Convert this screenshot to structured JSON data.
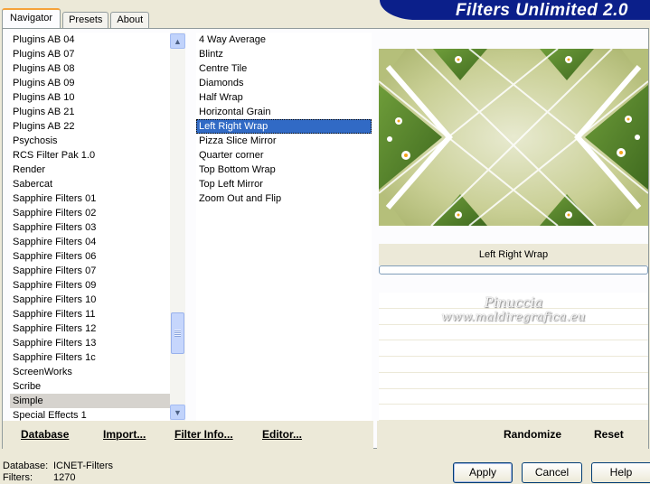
{
  "header": {
    "title": "Filters Unlimited 2.0",
    "color": "#0b1f8a"
  },
  "tabs": [
    {
      "label": "Navigator",
      "active": true
    },
    {
      "label": "Presets",
      "active": false
    },
    {
      "label": "About",
      "active": false
    }
  ],
  "categories": {
    "items": [
      "Plugins AB 04",
      "Plugins AB 07",
      "Plugins AB 08",
      "Plugins AB 09",
      "Plugins AB 10",
      "Plugins AB 21",
      "Plugins AB 22",
      "Psychosis",
      "RCS Filter Pak 1.0",
      "Render",
      "Sabercat",
      "Sapphire Filters 01",
      "Sapphire Filters 02",
      "Sapphire Filters 03",
      "Sapphire Filters 04",
      "Sapphire Filters 06",
      "Sapphire Filters 07",
      "Sapphire Filters 09",
      "Sapphire Filters 10",
      "Sapphire Filters 11",
      "Sapphire Filters 12",
      "Sapphire Filters 13",
      "Sapphire Filters 1c",
      "ScreenWorks",
      "Scribe",
      "Simple",
      "Special Effects 1"
    ],
    "selected": "Simple"
  },
  "filters": {
    "items": [
      "4 Way Average",
      "Blintz",
      "Centre Tile",
      "Diamonds",
      "Half Wrap",
      "Horizontal Grain",
      "Left Right Wrap",
      "Pizza Slice Mirror",
      "Quarter corner",
      "Top Bottom Wrap",
      "Top Left Mirror",
      "Zoom Out and Flip"
    ],
    "selected": "Left Right Wrap"
  },
  "preview": {
    "filter_name": "Left Right Wrap",
    "progress": 0
  },
  "watermark": {
    "line1": "Pinuccia",
    "line2": "www.maldiregrafica.eu"
  },
  "bottom_left": {
    "database": "Database",
    "import": "Import...",
    "filter_info": "Filter Info...",
    "editor": "Editor..."
  },
  "bottom_right": {
    "randomize": "Randomize",
    "reset": "Reset"
  },
  "status": {
    "database_label": "Database:",
    "database_value": "ICNET-Filters",
    "filters_label": "Filters:",
    "filters_value": "1270"
  },
  "buttons": {
    "apply": "Apply",
    "cancel": "Cancel",
    "help": "Help"
  }
}
